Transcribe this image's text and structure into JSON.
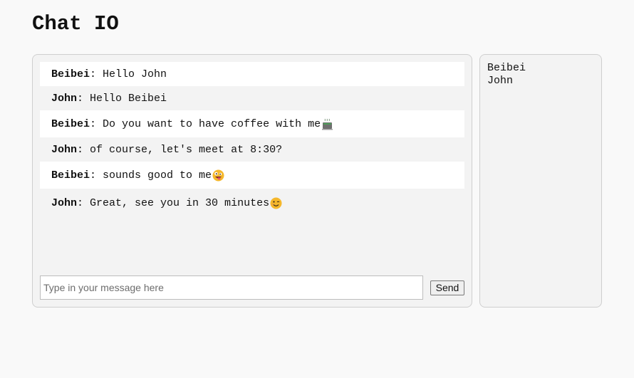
{
  "app": {
    "title": "Chat IO"
  },
  "messages": [
    {
      "sender": "Beibei",
      "text": "Hello John",
      "emoji": ""
    },
    {
      "sender": "John",
      "text": "Hello Beibei",
      "emoji": ""
    },
    {
      "sender": "Beibei",
      "text": "Do you want to have coffee with me",
      "emoji": "coffee-emoji"
    },
    {
      "sender": "John",
      "text": "of course, let's meet at 8:30?",
      "emoji": ""
    },
    {
      "sender": "Beibei",
      "text": "sounds good to me",
      "emoji": "zany-face-emoji"
    },
    {
      "sender": "John",
      "text": "Great, see you in 30 minutes",
      "emoji": "winking-face-emoji"
    }
  ],
  "composer": {
    "placeholder": "Type in your message here",
    "value": "",
    "send_label": "Send"
  },
  "users": [
    {
      "name": "Beibei"
    },
    {
      "name": "John"
    }
  ],
  "colors": {
    "page_bg": "#f9f9f9",
    "panel_bg": "#f3f3f3",
    "panel_border": "#cfcfcf",
    "row_highlight": "#ffffff"
  }
}
